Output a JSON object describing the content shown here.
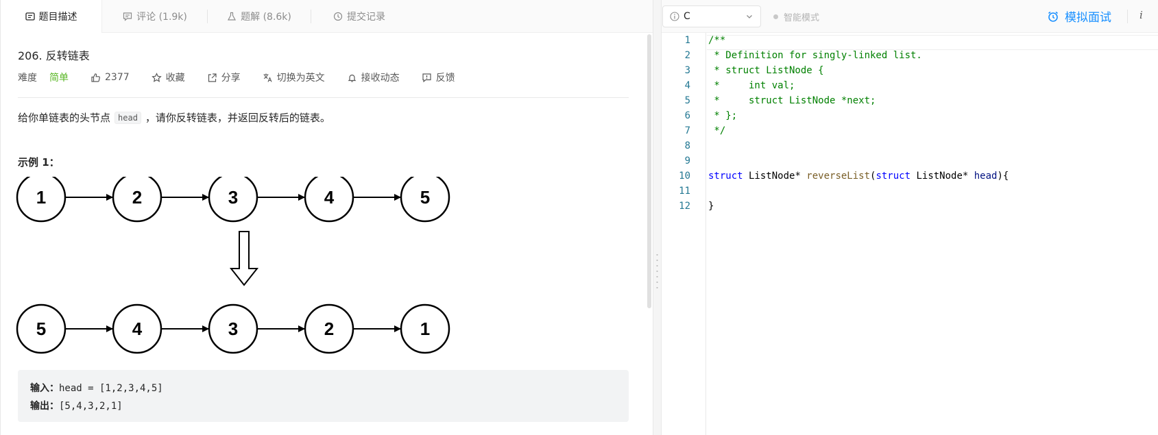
{
  "tabs": [
    {
      "label": "题目描述",
      "icon": "description-icon"
    },
    {
      "label": "评论 (1.9k)",
      "icon": "comment-icon"
    },
    {
      "label": "题解 (8.6k)",
      "icon": "flask-icon"
    },
    {
      "label": "提交记录",
      "icon": "history-icon"
    }
  ],
  "problem": {
    "title": "206. 反转链表",
    "difficulty_label": "难度",
    "difficulty": "简单",
    "likes": "2377",
    "favorite": "收藏",
    "share": "分享",
    "translate": "切换为英文",
    "notify": "接收动态",
    "feedback": "反馈",
    "desc_before": "给你单链表的头节点",
    "desc_code": "head",
    "desc_after": "，请你反转链表，并返回反转后的链表。",
    "example_title": "示例 1：",
    "example_input_label": "输入：",
    "example_input": "head = [1,2,3,4,5]",
    "example_output_label": "输出：",
    "example_output": "[5,4,3,2,1]"
  },
  "diagram": {
    "top_nodes": [
      "1",
      "2",
      "3",
      "4",
      "5"
    ],
    "bottom_nodes": [
      "5",
      "4",
      "3",
      "2",
      "1"
    ]
  },
  "toolbar": {
    "language": "C",
    "smart_mode": "智能模式",
    "mock_interview": "模拟面试",
    "info": "i"
  },
  "editor": {
    "line_numbers": [
      "1",
      "2",
      "3",
      "4",
      "5",
      "6",
      "7",
      "8",
      "9",
      "10",
      "11",
      "12"
    ],
    "lines": [
      "/**",
      " * Definition for singly-linked list.",
      " * struct ListNode {",
      " *     int val;",
      " *     struct ListNode *next;",
      " * };",
      " */",
      "",
      "",
      "",
      "",
      "}"
    ],
    "line10": {
      "kw1": "struct",
      "type1": " ListNode",
      "star1": "* ",
      "fn": "reverseList",
      "paren_open": "(",
      "kw2": "struct",
      "type2": " ListNode",
      "star2": "* ",
      "param": "head",
      "tail": "){"
    }
  },
  "colors": {
    "accent": "#1a90ff",
    "easy": "#5ab726",
    "comment": "#008000",
    "keyword": "#0000ff",
    "line_number": "#237893"
  }
}
